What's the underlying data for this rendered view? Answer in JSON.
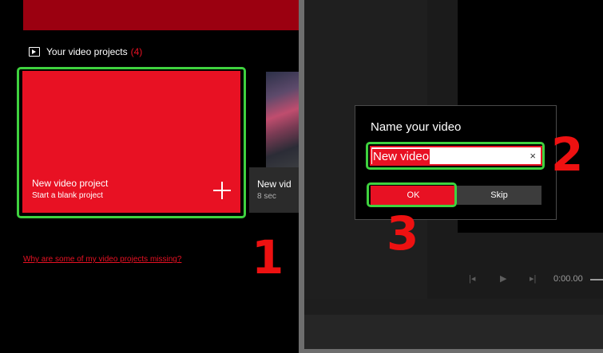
{
  "projects": {
    "header_label": "Your video projects",
    "count": "(4)",
    "new_card": {
      "title": "New video project",
      "subtitle": "Start a blank project"
    },
    "thumb_card": {
      "title": "New vid",
      "duration": "8 sec"
    },
    "missing_link": "Why are some of my video projects missing?"
  },
  "dialog": {
    "title": "Name your video",
    "input_value": "New video",
    "clear_symbol": "×",
    "ok_label": "OK",
    "skip_label": "Skip"
  },
  "playback": {
    "time": "0:00.00"
  },
  "step_markers": {
    "one": "1",
    "two": "2",
    "three": "3"
  },
  "colors": {
    "accent": "#e81123",
    "highlight": "#3fd23f",
    "marker": "#ee1111"
  }
}
